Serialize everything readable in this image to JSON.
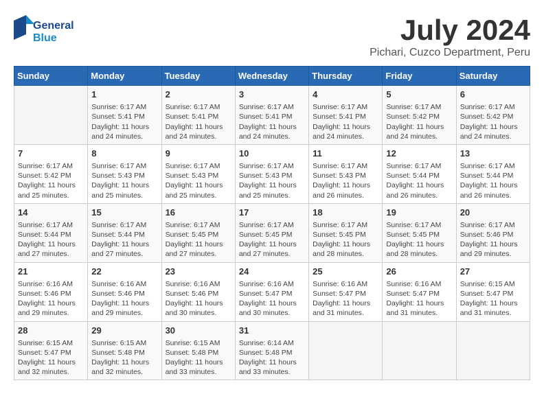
{
  "header": {
    "logo_general": "General",
    "logo_blue": "Blue",
    "month_title": "July 2024",
    "location": "Pichari, Cuzco Department, Peru"
  },
  "days_of_week": [
    "Sunday",
    "Monday",
    "Tuesday",
    "Wednesday",
    "Thursday",
    "Friday",
    "Saturday"
  ],
  "weeks": [
    [
      {
        "day": "",
        "sunrise": "",
        "sunset": "",
        "daylight": ""
      },
      {
        "day": "1",
        "sunrise": "Sunrise: 6:17 AM",
        "sunset": "Sunset: 5:41 PM",
        "daylight": "Daylight: 11 hours and 24 minutes."
      },
      {
        "day": "2",
        "sunrise": "Sunrise: 6:17 AM",
        "sunset": "Sunset: 5:41 PM",
        "daylight": "Daylight: 11 hours and 24 minutes."
      },
      {
        "day": "3",
        "sunrise": "Sunrise: 6:17 AM",
        "sunset": "Sunset: 5:41 PM",
        "daylight": "Daylight: 11 hours and 24 minutes."
      },
      {
        "day": "4",
        "sunrise": "Sunrise: 6:17 AM",
        "sunset": "Sunset: 5:41 PM",
        "daylight": "Daylight: 11 hours and 24 minutes."
      },
      {
        "day": "5",
        "sunrise": "Sunrise: 6:17 AM",
        "sunset": "Sunset: 5:42 PM",
        "daylight": "Daylight: 11 hours and 24 minutes."
      },
      {
        "day": "6",
        "sunrise": "Sunrise: 6:17 AM",
        "sunset": "Sunset: 5:42 PM",
        "daylight": "Daylight: 11 hours and 24 minutes."
      }
    ],
    [
      {
        "day": "7",
        "sunrise": "Sunrise: 6:17 AM",
        "sunset": "Sunset: 5:42 PM",
        "daylight": "Daylight: 11 hours and 25 minutes."
      },
      {
        "day": "8",
        "sunrise": "Sunrise: 6:17 AM",
        "sunset": "Sunset: 5:43 PM",
        "daylight": "Daylight: 11 hours and 25 minutes."
      },
      {
        "day": "9",
        "sunrise": "Sunrise: 6:17 AM",
        "sunset": "Sunset: 5:43 PM",
        "daylight": "Daylight: 11 hours and 25 minutes."
      },
      {
        "day": "10",
        "sunrise": "Sunrise: 6:17 AM",
        "sunset": "Sunset: 5:43 PM",
        "daylight": "Daylight: 11 hours and 25 minutes."
      },
      {
        "day": "11",
        "sunrise": "Sunrise: 6:17 AM",
        "sunset": "Sunset: 5:43 PM",
        "daylight": "Daylight: 11 hours and 26 minutes."
      },
      {
        "day": "12",
        "sunrise": "Sunrise: 6:17 AM",
        "sunset": "Sunset: 5:44 PM",
        "daylight": "Daylight: 11 hours and 26 minutes."
      },
      {
        "day": "13",
        "sunrise": "Sunrise: 6:17 AM",
        "sunset": "Sunset: 5:44 PM",
        "daylight": "Daylight: 11 hours and 26 minutes."
      }
    ],
    [
      {
        "day": "14",
        "sunrise": "Sunrise: 6:17 AM",
        "sunset": "Sunset: 5:44 PM",
        "daylight": "Daylight: 11 hours and 27 minutes."
      },
      {
        "day": "15",
        "sunrise": "Sunrise: 6:17 AM",
        "sunset": "Sunset: 5:44 PM",
        "daylight": "Daylight: 11 hours and 27 minutes."
      },
      {
        "day": "16",
        "sunrise": "Sunrise: 6:17 AM",
        "sunset": "Sunset: 5:45 PM",
        "daylight": "Daylight: 11 hours and 27 minutes."
      },
      {
        "day": "17",
        "sunrise": "Sunrise: 6:17 AM",
        "sunset": "Sunset: 5:45 PM",
        "daylight": "Daylight: 11 hours and 27 minutes."
      },
      {
        "day": "18",
        "sunrise": "Sunrise: 6:17 AM",
        "sunset": "Sunset: 5:45 PM",
        "daylight": "Daylight: 11 hours and 28 minutes."
      },
      {
        "day": "19",
        "sunrise": "Sunrise: 6:17 AM",
        "sunset": "Sunset: 5:45 PM",
        "daylight": "Daylight: 11 hours and 28 minutes."
      },
      {
        "day": "20",
        "sunrise": "Sunrise: 6:17 AM",
        "sunset": "Sunset: 5:46 PM",
        "daylight": "Daylight: 11 hours and 29 minutes."
      }
    ],
    [
      {
        "day": "21",
        "sunrise": "Sunrise: 6:16 AM",
        "sunset": "Sunset: 5:46 PM",
        "daylight": "Daylight: 11 hours and 29 minutes."
      },
      {
        "day": "22",
        "sunrise": "Sunrise: 6:16 AM",
        "sunset": "Sunset: 5:46 PM",
        "daylight": "Daylight: 11 hours and 29 minutes."
      },
      {
        "day": "23",
        "sunrise": "Sunrise: 6:16 AM",
        "sunset": "Sunset: 5:46 PM",
        "daylight": "Daylight: 11 hours and 30 minutes."
      },
      {
        "day": "24",
        "sunrise": "Sunrise: 6:16 AM",
        "sunset": "Sunset: 5:47 PM",
        "daylight": "Daylight: 11 hours and 30 minutes."
      },
      {
        "day": "25",
        "sunrise": "Sunrise: 6:16 AM",
        "sunset": "Sunset: 5:47 PM",
        "daylight": "Daylight: 11 hours and 31 minutes."
      },
      {
        "day": "26",
        "sunrise": "Sunrise: 6:16 AM",
        "sunset": "Sunset: 5:47 PM",
        "daylight": "Daylight: 11 hours and 31 minutes."
      },
      {
        "day": "27",
        "sunrise": "Sunrise: 6:15 AM",
        "sunset": "Sunset: 5:47 PM",
        "daylight": "Daylight: 11 hours and 31 minutes."
      }
    ],
    [
      {
        "day": "28",
        "sunrise": "Sunrise: 6:15 AM",
        "sunset": "Sunset: 5:47 PM",
        "daylight": "Daylight: 11 hours and 32 minutes."
      },
      {
        "day": "29",
        "sunrise": "Sunrise: 6:15 AM",
        "sunset": "Sunset: 5:48 PM",
        "daylight": "Daylight: 11 hours and 32 minutes."
      },
      {
        "day": "30",
        "sunrise": "Sunrise: 6:15 AM",
        "sunset": "Sunset: 5:48 PM",
        "daylight": "Daylight: 11 hours and 33 minutes."
      },
      {
        "day": "31",
        "sunrise": "Sunrise: 6:14 AM",
        "sunset": "Sunset: 5:48 PM",
        "daylight": "Daylight: 11 hours and 33 minutes."
      },
      {
        "day": "",
        "sunrise": "",
        "sunset": "",
        "daylight": ""
      },
      {
        "day": "",
        "sunrise": "",
        "sunset": "",
        "daylight": ""
      },
      {
        "day": "",
        "sunrise": "",
        "sunset": "",
        "daylight": ""
      }
    ]
  ]
}
